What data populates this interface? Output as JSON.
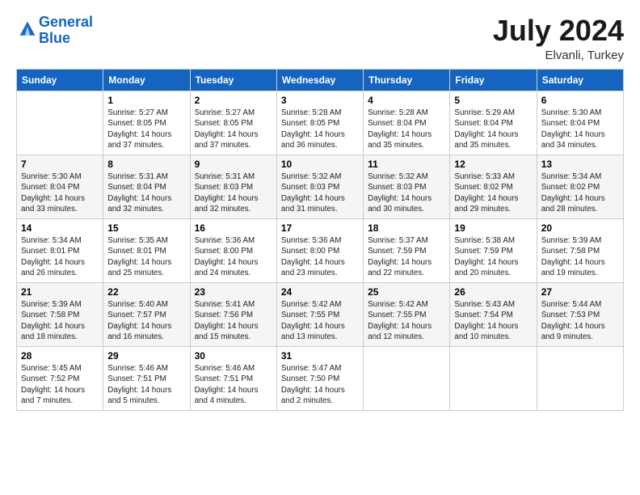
{
  "logo": {
    "line1": "General",
    "line2": "Blue"
  },
  "title": "July 2024",
  "subtitle": "Elvanli, Turkey",
  "weekdays": [
    "Sunday",
    "Monday",
    "Tuesday",
    "Wednesday",
    "Thursday",
    "Friday",
    "Saturday"
  ],
  "weeks": [
    [
      {
        "num": "",
        "info": ""
      },
      {
        "num": "1",
        "info": "Sunrise: 5:27 AM\nSunset: 8:05 PM\nDaylight: 14 hours\nand 37 minutes."
      },
      {
        "num": "2",
        "info": "Sunrise: 5:27 AM\nSunset: 8:05 PM\nDaylight: 14 hours\nand 37 minutes."
      },
      {
        "num": "3",
        "info": "Sunrise: 5:28 AM\nSunset: 8:05 PM\nDaylight: 14 hours\nand 36 minutes."
      },
      {
        "num": "4",
        "info": "Sunrise: 5:28 AM\nSunset: 8:04 PM\nDaylight: 14 hours\nand 35 minutes."
      },
      {
        "num": "5",
        "info": "Sunrise: 5:29 AM\nSunset: 8:04 PM\nDaylight: 14 hours\nand 35 minutes."
      },
      {
        "num": "6",
        "info": "Sunrise: 5:30 AM\nSunset: 8:04 PM\nDaylight: 14 hours\nand 34 minutes."
      }
    ],
    [
      {
        "num": "7",
        "info": "Sunrise: 5:30 AM\nSunset: 8:04 PM\nDaylight: 14 hours\nand 33 minutes."
      },
      {
        "num": "8",
        "info": "Sunrise: 5:31 AM\nSunset: 8:04 PM\nDaylight: 14 hours\nand 32 minutes."
      },
      {
        "num": "9",
        "info": "Sunrise: 5:31 AM\nSunset: 8:03 PM\nDaylight: 14 hours\nand 32 minutes."
      },
      {
        "num": "10",
        "info": "Sunrise: 5:32 AM\nSunset: 8:03 PM\nDaylight: 14 hours\nand 31 minutes."
      },
      {
        "num": "11",
        "info": "Sunrise: 5:32 AM\nSunset: 8:03 PM\nDaylight: 14 hours\nand 30 minutes."
      },
      {
        "num": "12",
        "info": "Sunrise: 5:33 AM\nSunset: 8:02 PM\nDaylight: 14 hours\nand 29 minutes."
      },
      {
        "num": "13",
        "info": "Sunrise: 5:34 AM\nSunset: 8:02 PM\nDaylight: 14 hours\nand 28 minutes."
      }
    ],
    [
      {
        "num": "14",
        "info": "Sunrise: 5:34 AM\nSunset: 8:01 PM\nDaylight: 14 hours\nand 26 minutes."
      },
      {
        "num": "15",
        "info": "Sunrise: 5:35 AM\nSunset: 8:01 PM\nDaylight: 14 hours\nand 25 minutes."
      },
      {
        "num": "16",
        "info": "Sunrise: 5:36 AM\nSunset: 8:00 PM\nDaylight: 14 hours\nand 24 minutes."
      },
      {
        "num": "17",
        "info": "Sunrise: 5:36 AM\nSunset: 8:00 PM\nDaylight: 14 hours\nand 23 minutes."
      },
      {
        "num": "18",
        "info": "Sunrise: 5:37 AM\nSunset: 7:59 PM\nDaylight: 14 hours\nand 22 minutes."
      },
      {
        "num": "19",
        "info": "Sunrise: 5:38 AM\nSunset: 7:59 PM\nDaylight: 14 hours\nand 20 minutes."
      },
      {
        "num": "20",
        "info": "Sunrise: 5:39 AM\nSunset: 7:58 PM\nDaylight: 14 hours\nand 19 minutes."
      }
    ],
    [
      {
        "num": "21",
        "info": "Sunrise: 5:39 AM\nSunset: 7:58 PM\nDaylight: 14 hours\nand 18 minutes."
      },
      {
        "num": "22",
        "info": "Sunrise: 5:40 AM\nSunset: 7:57 PM\nDaylight: 14 hours\nand 16 minutes."
      },
      {
        "num": "23",
        "info": "Sunrise: 5:41 AM\nSunset: 7:56 PM\nDaylight: 14 hours\nand 15 minutes."
      },
      {
        "num": "24",
        "info": "Sunrise: 5:42 AM\nSunset: 7:55 PM\nDaylight: 14 hours\nand 13 minutes."
      },
      {
        "num": "25",
        "info": "Sunrise: 5:42 AM\nSunset: 7:55 PM\nDaylight: 14 hours\nand 12 minutes."
      },
      {
        "num": "26",
        "info": "Sunrise: 5:43 AM\nSunset: 7:54 PM\nDaylight: 14 hours\nand 10 minutes."
      },
      {
        "num": "27",
        "info": "Sunrise: 5:44 AM\nSunset: 7:53 PM\nDaylight: 14 hours\nand 9 minutes."
      }
    ],
    [
      {
        "num": "28",
        "info": "Sunrise: 5:45 AM\nSunset: 7:52 PM\nDaylight: 14 hours\nand 7 minutes."
      },
      {
        "num": "29",
        "info": "Sunrise: 5:46 AM\nSunset: 7:51 PM\nDaylight: 14 hours\nand 5 minutes."
      },
      {
        "num": "30",
        "info": "Sunrise: 5:46 AM\nSunset: 7:51 PM\nDaylight: 14 hours\nand 4 minutes."
      },
      {
        "num": "31",
        "info": "Sunrise: 5:47 AM\nSunset: 7:50 PM\nDaylight: 14 hours\nand 2 minutes."
      },
      {
        "num": "",
        "info": ""
      },
      {
        "num": "",
        "info": ""
      },
      {
        "num": "",
        "info": ""
      }
    ]
  ]
}
